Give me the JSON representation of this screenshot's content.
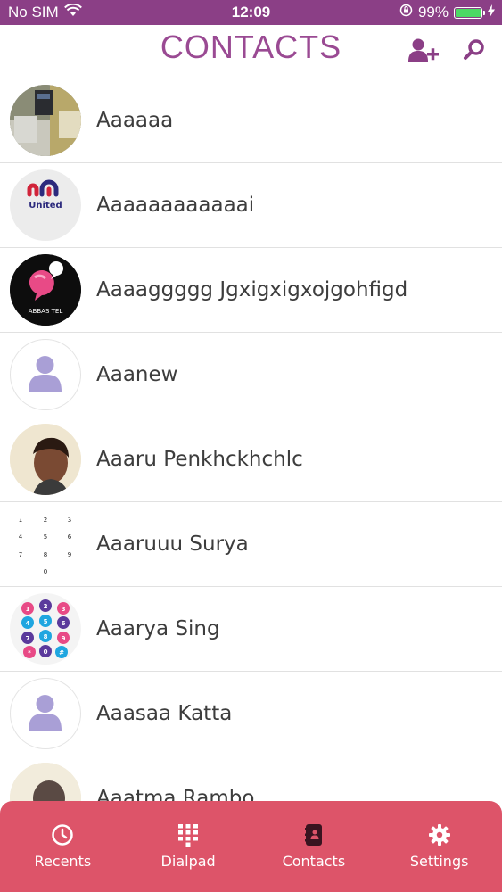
{
  "status_bar": {
    "carrier": "No SIM",
    "time": "12:09",
    "battery": "99%",
    "battery_level": 0.99
  },
  "header": {
    "title": "CONTACTS"
  },
  "contacts": [
    {
      "name": "Aaaaaa",
      "avatar": "photo"
    },
    {
      "name": "Aaaaaaaaaaaai",
      "avatar": "logo-united",
      "logo_text": "United"
    },
    {
      "name": "Aaaaggggg Jgxigxigxojgohfigd",
      "avatar": "logo-abbas",
      "logo_text": "ABBAS TEL"
    },
    {
      "name": "Aaanew",
      "avatar": "placeholder"
    },
    {
      "name": "Aaaru Penkhckhchlc",
      "avatar": "photo-person"
    },
    {
      "name": "Aaaruuu Surya",
      "avatar": "keypad",
      "keys": [
        "1",
        "2",
        "3",
        "4",
        "5",
        "6",
        "7",
        "8",
        "9",
        "0"
      ]
    },
    {
      "name": "Aaarya Sing",
      "avatar": "colorful-keypad",
      "keys": [
        "1",
        "2",
        "3",
        "4",
        "5",
        "6",
        "7",
        "8",
        "9",
        "*",
        "0",
        "#"
      ]
    },
    {
      "name": "Aaasaa Katta",
      "avatar": "placeholder"
    },
    {
      "name": "Aaatma Rambo",
      "avatar": "photo-person"
    }
  ],
  "tabs": [
    {
      "label": "Recents",
      "icon": "clock-icon"
    },
    {
      "label": "Dialpad",
      "icon": "dialpad-icon"
    },
    {
      "label": "Contacts",
      "icon": "contacts-book-icon",
      "active": true
    },
    {
      "label": "Settings",
      "icon": "gear-icon"
    }
  ],
  "colors": {
    "primary": "#8b3f86",
    "title": "#9a4a93",
    "tabbar": "#dd5469",
    "placeholder": "#a99fd6"
  }
}
